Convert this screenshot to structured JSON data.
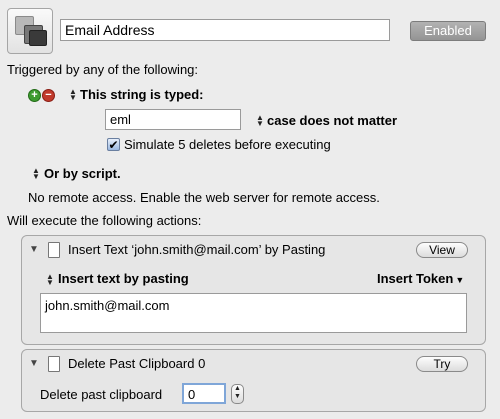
{
  "macro": {
    "name": "Email Address",
    "enabled_label": "Enabled"
  },
  "triggers": {
    "heading": "Triggered by any of the following:",
    "string_trigger": {
      "type_label": "This string is typed:",
      "value": "eml",
      "case_option": "case does not matter",
      "simulate_checked": true,
      "simulate_label": "Simulate 5 deletes before executing"
    },
    "or_label": "Or by script.",
    "remote_note": "No remote access.  Enable the web server for remote access."
  },
  "actions": {
    "heading": "Will execute the following actions:",
    "items": [
      {
        "title": "Insert Text ‘john.smith@mail.com’ by Pasting",
        "button": "View",
        "mode_label": "Insert text by pasting",
        "token_label": "Insert Token",
        "text": "john.smith@mail.com"
      },
      {
        "title": "Delete Past Clipboard 0",
        "button": "Try",
        "field_label": "Delete past clipboard",
        "field_value": "0"
      }
    ]
  },
  "icons": {
    "macro_icon": "macro-group-icon",
    "add": "plus-icon",
    "remove": "minus-icon",
    "updown": "updown-arrows-icon",
    "disclosure": "disclosure-triangle-icon",
    "action": "document-icon",
    "checkmark": "checkmark-icon",
    "dropdown": "dropdown-arrow-icon",
    "stepper": "stepper-icon"
  },
  "colors": {
    "background": "#ececec",
    "add_green": "#3d9b2f",
    "remove_red": "#c0392b",
    "enabled_gray": "#a3a3a3"
  }
}
